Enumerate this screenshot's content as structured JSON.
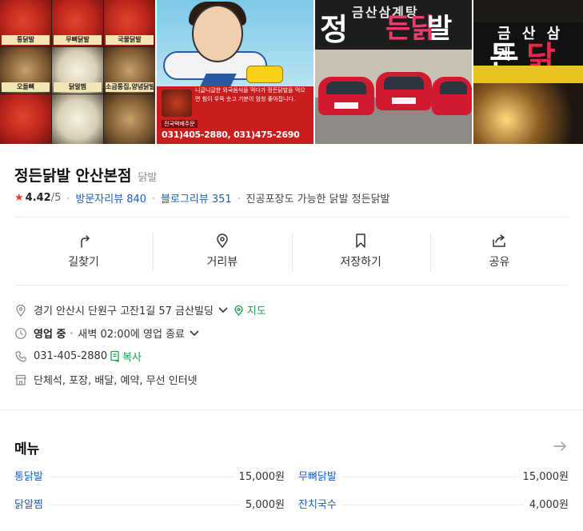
{
  "photos": {
    "photo1": {
      "labels": [
        "통닭발",
        "무뼈닭발",
        "국물닭발",
        "오돌뼈",
        "닭알찜",
        "소금통집,양념닭발"
      ]
    },
    "photo2": {
      "text": "니글니글한 외국음식을 먹다가 정든닭발을 먹으면 힘이 우뚝 솟고 기분이 엄청 좋아집니다.",
      "tag": "전국택배주문",
      "phone": "031)405-2880, 031)475-2690"
    },
    "photo3": {
      "sign_top": "금산삼계탕",
      "sign_left": "정",
      "sign_mid": "든닭",
      "sign_right": "발"
    },
    "photo4": {
      "sign_top": "금 산 삼 계",
      "sign_left": "든",
      "sign_right": "닭"
    }
  },
  "place": {
    "name": "정든닭발 안산본점",
    "category": "닭발",
    "rating": "4.42",
    "rating_max": "/5",
    "visitor_reviews_label": "방문자리뷰",
    "visitor_reviews_count": "840",
    "blog_reviews_label": "블로그리뷰",
    "blog_reviews_count": "351",
    "tagline": "진공포장도 가능한 닭발 정든닭발"
  },
  "actions": [
    {
      "label": "길찾기",
      "icon": "directions-icon"
    },
    {
      "label": "거리뷰",
      "icon": "location-pin-icon"
    },
    {
      "label": "저장하기",
      "icon": "bookmark-icon"
    },
    {
      "label": "공유",
      "icon": "share-icon"
    }
  ],
  "info": {
    "address": "경기 안산시 단원구 고잔1길 57 금산빌딩",
    "map_label": "지도",
    "status": "영업 중",
    "hours": "새벽 02:00에 영업 종료",
    "phone": "031-405-2880",
    "copy_label": "복사",
    "amenities": "단체석, 포장, 배달, 예약, 무선 인터넷"
  },
  "menu": {
    "title": "메뉴",
    "items": [
      {
        "name": "통닭발",
        "price": "15,000원"
      },
      {
        "name": "무뼈닭발",
        "price": "15,000원"
      },
      {
        "name": "닭알찜",
        "price": "5,000원"
      },
      {
        "name": "잔치국수",
        "price": "4,000원"
      }
    ]
  },
  "colors": {
    "link": "#1d5fbf",
    "accent_green": "#19a34a",
    "star": "#e8402f"
  }
}
